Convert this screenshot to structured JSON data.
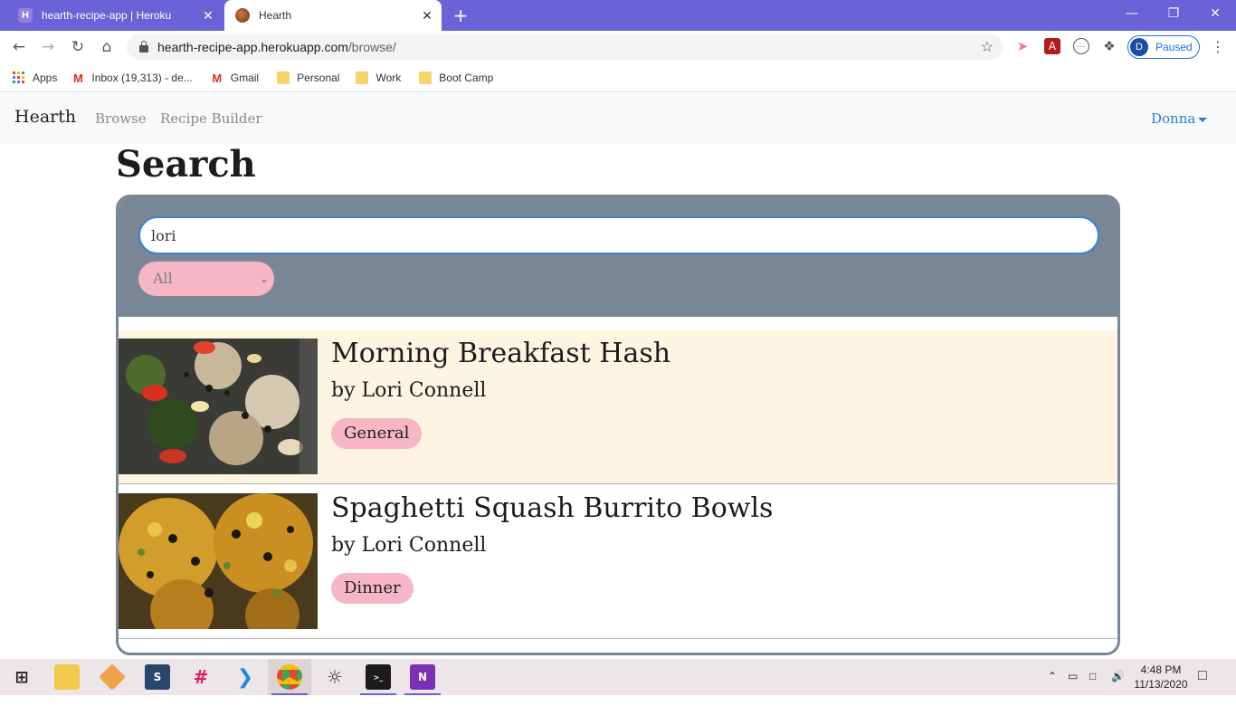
{
  "browser": {
    "tabs": [
      {
        "title": "hearth-recipe-app | Heroku",
        "favicon": "heroku-icon",
        "active": false
      },
      {
        "title": "Hearth",
        "favicon": "hearth-icon",
        "active": true
      }
    ],
    "url_host": "hearth-recipe-app.herokuapp.com",
    "url_path": "/browse/",
    "profile_initial": "D",
    "profile_status": "Paused",
    "bookmarks": [
      {
        "label": "Apps",
        "icon": "apps-grid-icon"
      },
      {
        "label": "Inbox (19,313) - de...",
        "icon": "gmail-icon"
      },
      {
        "label": "Gmail",
        "icon": "gmail-icon"
      },
      {
        "label": "Personal",
        "icon": "folder-icon"
      },
      {
        "label": "Work",
        "icon": "folder-icon"
      },
      {
        "label": "Boot Camp",
        "icon": "folder-icon"
      }
    ]
  },
  "navbar": {
    "brand": "Hearth",
    "links": [
      "Browse",
      "Recipe Builder"
    ],
    "user": "Donna"
  },
  "search": {
    "heading": "Search",
    "query": "lori",
    "filter_selected": "All"
  },
  "results": [
    {
      "title": "Morning Breakfast Hash",
      "author": "by Lori Connell",
      "tag": "General"
    },
    {
      "title": "Spaghetti Squash Burrito Bowls",
      "author": "by Lori Connell",
      "tag": "Dinner"
    }
  ],
  "taskbar": {
    "time": "4:48 PM",
    "date": "11/13/2020",
    "apps": [
      "windows-start-icon",
      "file-explorer-icon",
      "git-icon",
      "mysql-workbench-icon",
      "slack-icon",
      "vscode-icon",
      "chrome-icon",
      "globe-icon",
      "terminal-icon",
      "onenote-icon"
    ]
  },
  "colors": {
    "chrome_frame": "#6a63d8",
    "panel": "#798696",
    "tag_pink": "#f7b6c6",
    "highlight_row": "#fdf4e1",
    "link_blue": "#2a7fd4"
  }
}
